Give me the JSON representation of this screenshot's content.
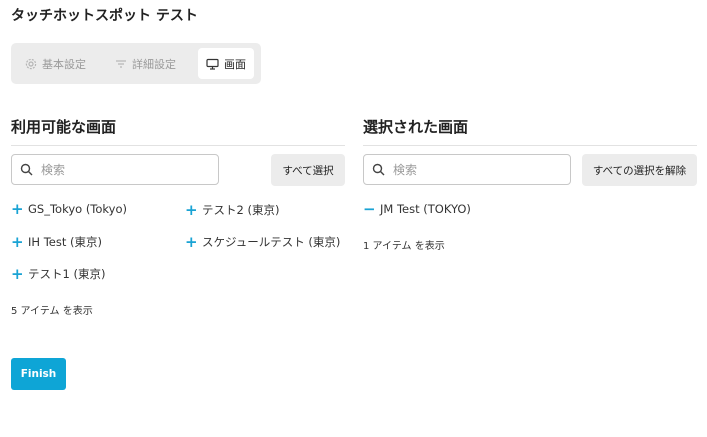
{
  "page_title": "タッチホットスポット テスト",
  "tabs": [
    {
      "label": "基本設定",
      "icon": "gear-icon",
      "active": false
    },
    {
      "label": "詳細設定",
      "icon": "filter-icon",
      "active": false
    },
    {
      "label": "画面",
      "icon": "monitor-icon",
      "active": true
    }
  ],
  "available": {
    "heading": "利用可能な画面",
    "search_placeholder": "検索",
    "select_all_label": "すべて選択",
    "items": [
      {
        "label": "GS_Tokyo (Tokyo)"
      },
      {
        "label": "テスト2 (東京)"
      },
      {
        "label": "IH Test (東京)"
      },
      {
        "label": "スケジュールテスト (東京)"
      },
      {
        "label": "テスト1 (東京)"
      }
    ],
    "count_text": "5 アイテム を表示"
  },
  "selected": {
    "heading": "選択された画面",
    "search_placeholder": "検索",
    "deselect_all_label": "すべての選択を解除",
    "items": [
      {
        "label": "JM Test (TOKYO)"
      }
    ],
    "count_text": "1 アイテム を表示"
  },
  "finish_label": "Finish",
  "colors": {
    "accent": "#0ea5d6",
    "plus_icon": "#1aa3d4",
    "tab_bg": "#ececec"
  }
}
